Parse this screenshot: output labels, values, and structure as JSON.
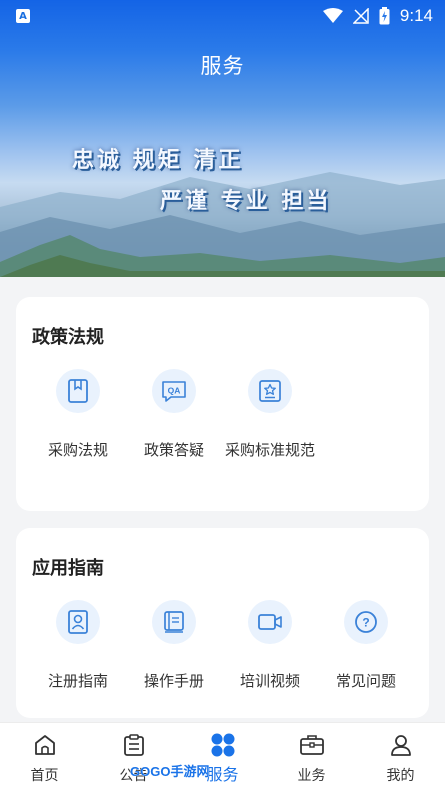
{
  "status_bar": {
    "time": "9:14"
  },
  "header": {
    "title": "服务"
  },
  "banner": {
    "slogan_line1": "忠诚  规矩  清正",
    "slogan_line2": "严谨  专业  担当"
  },
  "sections": [
    {
      "title": "政策法规",
      "items": [
        {
          "label": "采购法规",
          "icon": "book-icon"
        },
        {
          "label": "政策答疑",
          "icon": "qa-icon"
        },
        {
          "label": "采购标准规范",
          "icon": "standard-icon"
        }
      ]
    },
    {
      "title": "应用指南",
      "items": [
        {
          "label": "注册指南",
          "icon": "user-card-icon"
        },
        {
          "label": "操作手册",
          "icon": "manual-icon"
        },
        {
          "label": "培训视频",
          "icon": "video-icon"
        },
        {
          "label": "常见问题",
          "icon": "question-icon"
        }
      ]
    }
  ],
  "bottom_nav": [
    {
      "label": "首页",
      "icon": "home-icon"
    },
    {
      "label": "公告",
      "icon": "clipboard-icon"
    },
    {
      "label": "服务",
      "icon": "grid-icon",
      "active": true
    },
    {
      "label": "业务",
      "icon": "briefcase-icon"
    },
    {
      "label": "我的",
      "icon": "user-icon"
    }
  ],
  "watermark": {
    "text": "GOGO手游网"
  },
  "colors": {
    "accent": "#1a73e8",
    "icon_bg": "#e9f2fd",
    "icon_stroke": "#3b82d8"
  }
}
